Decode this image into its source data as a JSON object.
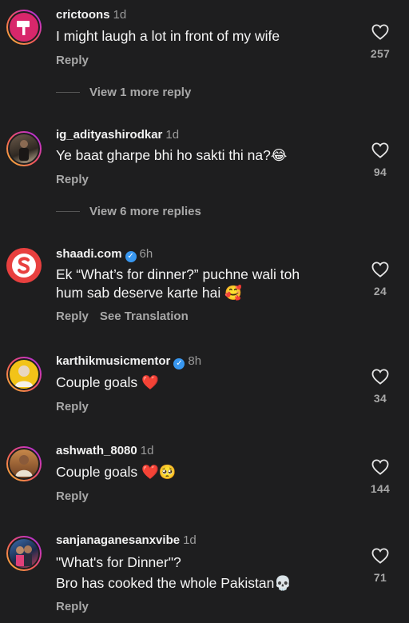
{
  "ui": {
    "reply_label": "Reply",
    "see_translation_label": "See Translation"
  },
  "colors": {
    "background": "#1e1e1f",
    "secondary_text": "#a8a8a8",
    "verified_badge": "#3897f0",
    "heart_red": "#e0243b"
  },
  "comments": [
    {
      "username": "crictoons",
      "time": "1d",
      "verified": false,
      "text": "I might laugh a lot in front of my wife",
      "likes": "257",
      "more_replies": "View 1 more reply",
      "avatar_icon": "hammer-logo-icon"
    },
    {
      "username": "ig_adityashirodkar",
      "time": "1d",
      "verified": false,
      "text": "Ye baat gharpe bhi ho sakti thi na?😂",
      "likes": "94",
      "more_replies": "View 6 more replies",
      "avatar_icon": "profile-photo"
    },
    {
      "username": "shaadi.com",
      "time": "6h",
      "verified": true,
      "text_line1": "Ek “What’s for dinner?” puchne wali toh",
      "text_line2": "hum sab deserve karte hai 🥰",
      "likes": "24",
      "avatar_icon": "shaadi-logo-icon"
    },
    {
      "username": "karthikmusicmentor",
      "time": "8h",
      "verified": true,
      "text": "Couple goals ❤️",
      "likes": "34",
      "avatar_icon": "profile-photo"
    },
    {
      "username": "ashwath_8080",
      "time": "1d",
      "verified": false,
      "text": "Couple goals ❤️🥺",
      "likes": "144",
      "avatar_icon": "profile-photo"
    },
    {
      "username": "sanjanaganesanxvibe",
      "time": "1d",
      "verified": false,
      "text_line1": "\"What's for Dinner\"?",
      "text_line2": "Bro has cooked the whole Pakistan💀",
      "likes": "71",
      "avatar_icon": "profile-photo"
    }
  ]
}
